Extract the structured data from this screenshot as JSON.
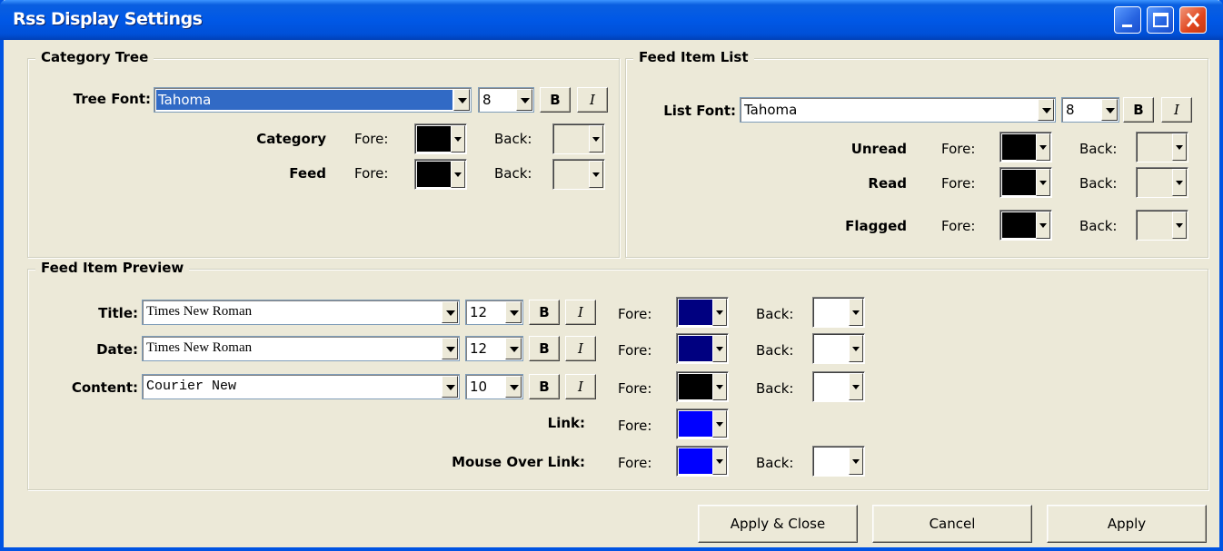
{
  "window": {
    "title": "Rss Display Settings"
  },
  "colors": {
    "black": "#000000",
    "navy": "#000080",
    "blue": "#0000ff",
    "white": "#ffffff"
  },
  "category_tree": {
    "group_label": "Category Tree",
    "font_label": "Tree Font:",
    "font_value": "Tahoma",
    "size_value": "8",
    "bold_label": "B",
    "italic_label": "I",
    "rows": [
      {
        "label": "Category",
        "fore_label": "Fore:",
        "back_label": "Back:",
        "fore_color": "#000000"
      },
      {
        "label": "Feed",
        "fore_label": "Fore:",
        "back_label": "Back:",
        "fore_color": "#000000"
      }
    ]
  },
  "feed_item_list": {
    "group_label": "Feed Item List",
    "font_label": "List Font:",
    "font_value": "Tahoma",
    "size_value": "8",
    "bold_label": "B",
    "italic_label": "I",
    "rows": [
      {
        "label": "Unread",
        "fore_label": "Fore:",
        "back_label": "Back:",
        "fore_color": "#000000"
      },
      {
        "label": "Read",
        "fore_label": "Fore:",
        "back_label": "Back:",
        "fore_color": "#000000"
      },
      {
        "label": "Flagged",
        "fore_label": "Fore:",
        "back_label": "Back:",
        "fore_color": "#000000"
      }
    ]
  },
  "feed_item_preview": {
    "group_label": "Feed Item Preview",
    "rows": [
      {
        "label": "Title:",
        "font_value": "Times New Roman",
        "size_value": "12",
        "bold_label": "B",
        "italic_label": "I",
        "fore_label": "Fore:",
        "back_label": "Back:",
        "fore_color": "#000080",
        "back_color": "#ffffff"
      },
      {
        "label": "Date:",
        "font_value": "Times New Roman",
        "size_value": "12",
        "bold_label": "B",
        "italic_label": "I",
        "fore_label": "Fore:",
        "back_label": "Back:",
        "fore_color": "#000080",
        "back_color": "#ffffff"
      },
      {
        "label": "Content:",
        "font_value": "Courier New",
        "size_value": "10",
        "bold_label": "B",
        "italic_label": "I",
        "fore_label": "Fore:",
        "back_label": "Back:",
        "fore_color": "#000000",
        "back_color": "#ffffff"
      }
    ],
    "link": {
      "label": "Link:",
      "fore_label": "Fore:",
      "fore_color": "#0000ff"
    },
    "mouse_over_link": {
      "label": "Mouse Over Link:",
      "fore_label": "Fore:",
      "back_label": "Back:",
      "fore_color": "#0000ff",
      "back_color": "#ffffff"
    }
  },
  "buttons": {
    "apply_close": "Apply & Close",
    "cancel": "Cancel",
    "apply": "Apply"
  }
}
